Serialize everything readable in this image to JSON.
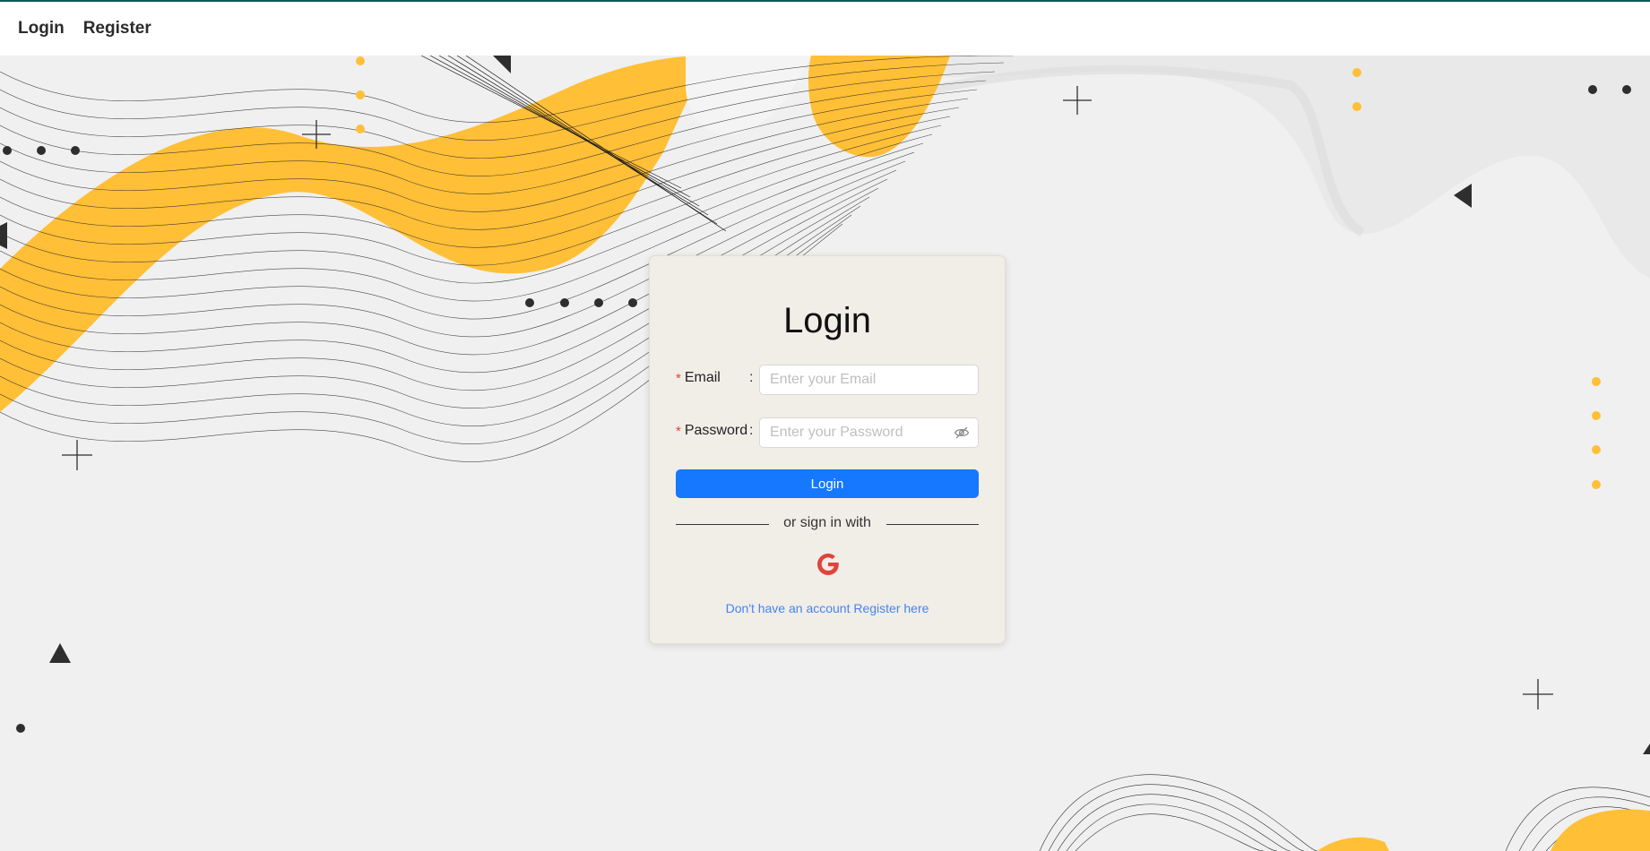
{
  "nav": {
    "login_label": "Login",
    "register_label": "Register"
  },
  "form": {
    "title": "Login",
    "email": {
      "required_mark": "*",
      "label": "Email",
      "separator": ":",
      "placeholder": "Enter your Email",
      "value": ""
    },
    "password": {
      "required_mark": "*",
      "label": "Password",
      "separator": ":",
      "placeholder": "Enter your Password",
      "value": "",
      "toggle_icon": "eye-invisible-icon"
    },
    "submit_label": "Login",
    "divider_text": "or sign in with",
    "social_icon": "google-icon",
    "register_prompt": "Don't have an account Register here"
  },
  "colors": {
    "primary": "#1677ff",
    "accent": "#ffbf37",
    "required": "#e0443a",
    "link": "#4285f4",
    "card_bg": "#f1ede7",
    "page_bg": "#f0f0f0",
    "top_border": "#0c5a5a"
  }
}
